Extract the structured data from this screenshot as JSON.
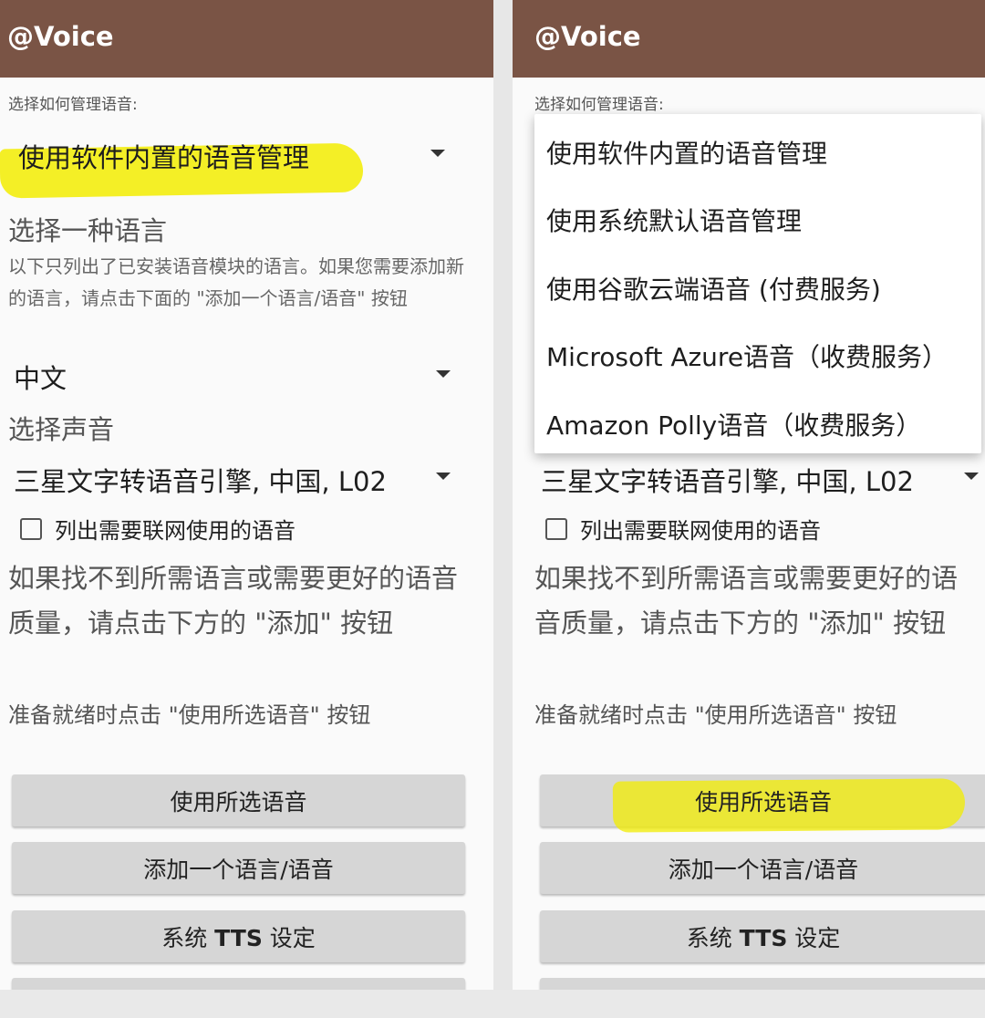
{
  "app": {
    "title": "@Voice"
  },
  "settings": {
    "manage_label": "选择如何管理语音:",
    "manage_selected": "使用软件内置的语音管理",
    "language_heading": "选择一种语言",
    "language_note": "以下只列出了已安装语音模块的语言。如果您需要添加新的语言，请点击下面的 \"添加一个语言/语音\" 按钮",
    "language_selected": "中文",
    "voice_heading": "选择声音",
    "voice_selected": "三星文字转语音引擎, 中国, L02",
    "online_checkbox_label": "列出需要联网使用的语音",
    "online_checkbox_checked": false,
    "help_text": "如果找不到所需语言或需要更好的语音质量，请点击下方的 \"添加\" 按钮",
    "ready_text": "准备就绪时点击 \"使用所选语音\" 按钮"
  },
  "buttons": {
    "use_selected": "使用所选语音",
    "add_language": "添加一个语言/语音",
    "system_tts_prefix": "系统 ",
    "system_tts_bold": "TTS",
    "system_tts_suffix": " 设定"
  },
  "dropdown_menu": {
    "items": [
      "使用软件内置的语音管理",
      "使用系统默认语音管理",
      "使用谷歌云端语音 (付费服务)",
      "Microsoft Azure语音（收费服务）",
      "Amazon Polly语音（收费服务）"
    ]
  },
  "colors": {
    "appbar": "#7a5445",
    "highlight": "#f2ec00",
    "button": "#d6d6d6",
    "background": "#fafafa"
  }
}
